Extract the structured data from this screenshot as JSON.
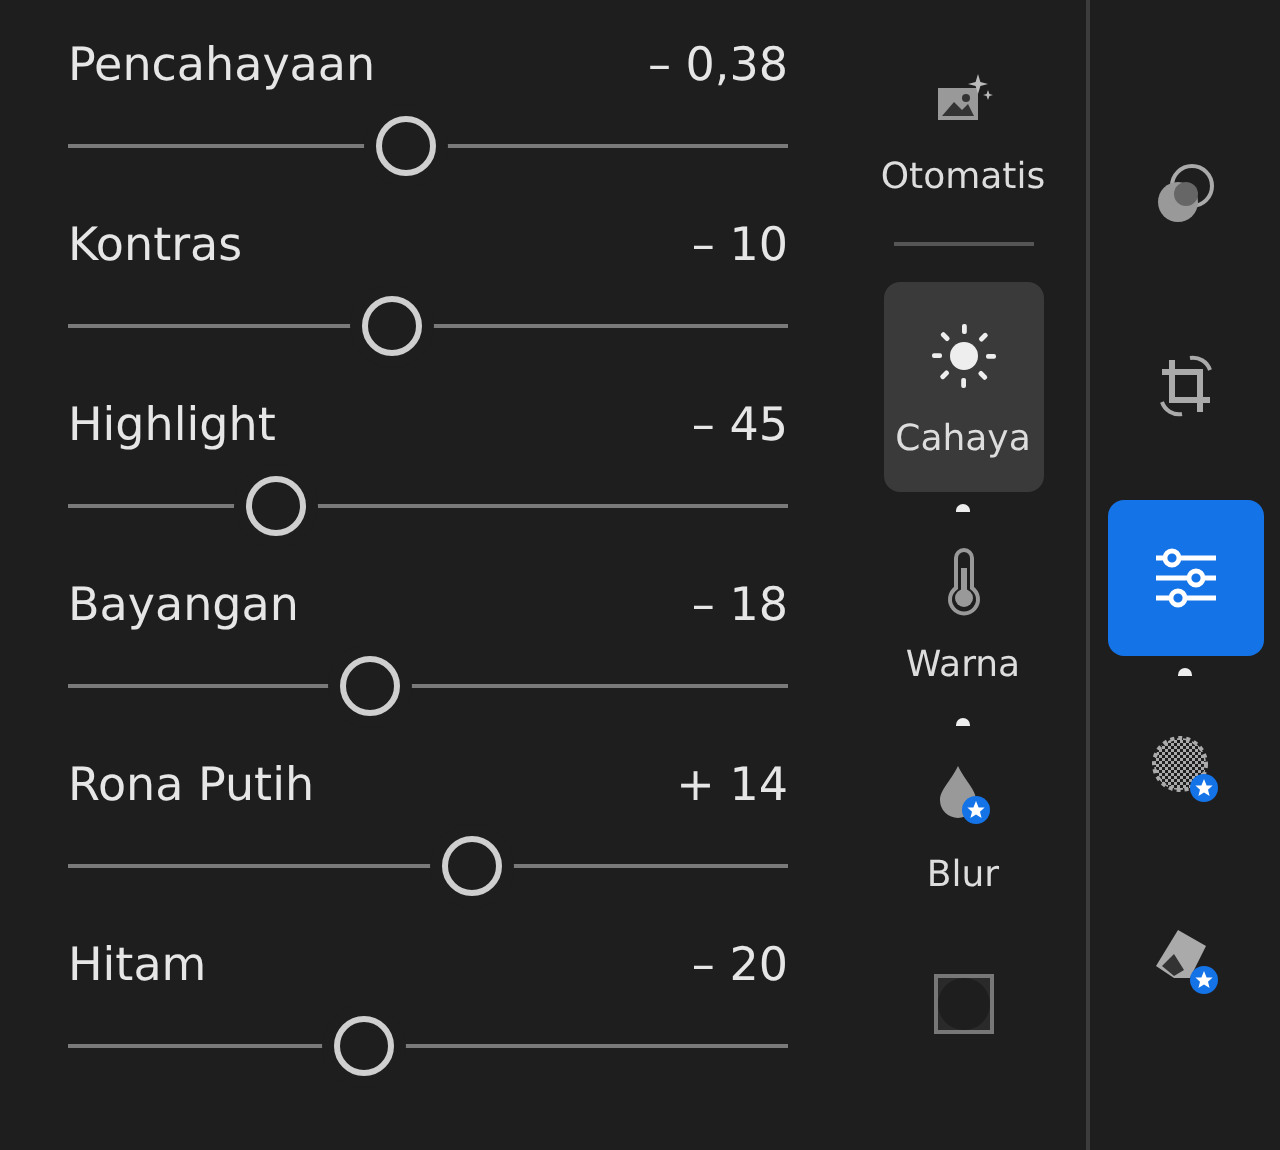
{
  "sliders": [
    {
      "label": "Pencahayaan",
      "value": "– 0,38",
      "level": 0.47
    },
    {
      "label": "Kontras",
      "value": "– 10",
      "level": 0.45
    },
    {
      "label": "Highlight",
      "value": "– 45",
      "level": 0.29
    },
    {
      "label": "Bayangan",
      "value": "– 18",
      "level": 0.42
    },
    {
      "label": "Rona Putih",
      "value": "+ 14",
      "level": 0.56
    },
    {
      "label": "Hitam",
      "value": "– 20",
      "level": 0.41
    }
  ],
  "categories": [
    {
      "kind": "auto",
      "label": "Otomatis",
      "selected": false,
      "modified": false
    },
    {
      "kind": "light",
      "label": "Cahaya",
      "selected": true,
      "modified": true
    },
    {
      "kind": "color",
      "label": "Warna",
      "selected": false,
      "modified": true
    },
    {
      "kind": "blur",
      "label": "Blur",
      "selected": false,
      "modified": false
    },
    {
      "kind": "vignette",
      "selected": false,
      "modified": false
    }
  ],
  "tools": [
    {
      "kind": "mask",
      "selected": false,
      "modified": false
    },
    {
      "kind": "crop",
      "selected": false,
      "modified": false
    },
    {
      "kind": "adjust",
      "selected": true,
      "modified": true
    },
    {
      "kind": "heal",
      "selected": false,
      "modified": false
    },
    {
      "kind": "eraser",
      "selected": false,
      "modified": false
    }
  ]
}
